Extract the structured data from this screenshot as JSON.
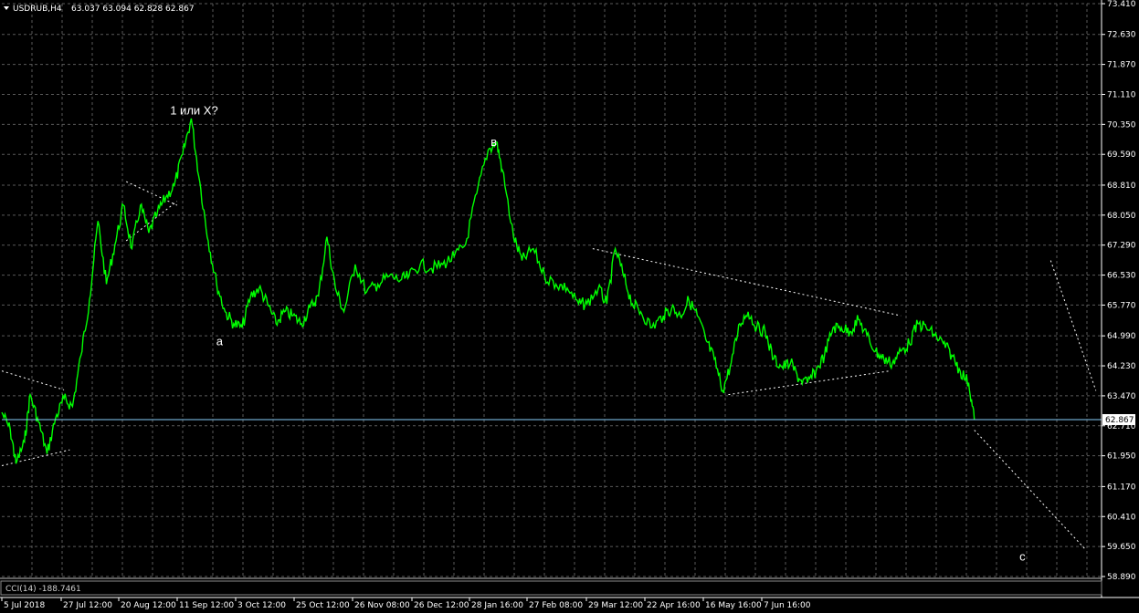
{
  "header": {
    "symbol": "USDRUB,H4",
    "ohlc": "63.037 63.094 62.828 62.867"
  },
  "indicator": {
    "label": "CCI(14) -188.7461"
  },
  "current_price": "62.867",
  "colors": {
    "background": "#000000",
    "price_line": "#00ff00",
    "grid": "#5a5a5a",
    "axis": "#ffffff",
    "annotation_line": "#ffffff",
    "current_price_line": "#87cefa"
  },
  "chart_data": {
    "type": "line",
    "title": "USDRUB,H4",
    "grid": true,
    "y_range": [
      58.89,
      73.41
    ],
    "x_ticks": [
      "5 Jul 2018",
      "27 Jul 12:00",
      "20 Aug 12:00",
      "11 Sep 12:00",
      "3 Oct 12:00",
      "25 Oct 12:00",
      "26 Nov 08:00",
      "26 Dec 12:00",
      "28 Jan 16:00",
      "27 Feb 08:00",
      "29 Mar 12:00",
      "22 Apr 16:00",
      "16 May 16:00",
      "7 Jun 16:00"
    ],
    "y_ticks": [
      "73.410",
      "72.630",
      "71.870",
      "71.110",
      "70.350",
      "69.590",
      "68.810",
      "68.050",
      "67.290",
      "66.530",
      "65.770",
      "64.990",
      "64.230",
      "63.470",
      "62.710",
      "61.950",
      "61.170",
      "60.410",
      "59.650",
      "58.890"
    ],
    "annotations": [
      {
        "text": "1 или X?",
        "x": "11 Sep 2018",
        "y": 70.6
      },
      {
        "text": "в",
        "x": "26 Dec 2018",
        "y": 69.8
      },
      {
        "text": "a",
        "x": "20 Sep 2018",
        "y": 64.75
      },
      {
        "text": "c",
        "x": "Jul 2019",
        "y": 59.3
      }
    ],
    "series": [
      {
        "values": [
          [
            "5 Jul 2018",
            63.05
          ],
          [
            "8 Jul 2018",
            62.6
          ],
          [
            "10 Jul 2018",
            61.75
          ],
          [
            "13 Jul 2018",
            62.3
          ],
          [
            "15 Jul 2018",
            63.5
          ],
          [
            "18 Jul 2018",
            62.8
          ],
          [
            "21 Jul 2018",
            62.0
          ],
          [
            "24 Jul 2018",
            62.9
          ],
          [
            "27 Jul 2018",
            63.4
          ],
          [
            "30 Jul 2018",
            63.2
          ],
          [
            "2 Aug 2018",
            64.5
          ],
          [
            "5 Aug 2018",
            65.9
          ],
          [
            "8 Aug 2018",
            67.9
          ],
          [
            "11 Aug 2018",
            66.3
          ],
          [
            "14 Aug 2018",
            67.3
          ],
          [
            "17 Aug 2018",
            68.3
          ],
          [
            "20 Aug 2018",
            67.2
          ],
          [
            "23 Aug 2018",
            68.3
          ],
          [
            "26 Aug 2018",
            67.6
          ],
          [
            "29 Aug 2018",
            68.1
          ],
          [
            "1 Sep 2018",
            68.5
          ],
          [
            "4 Sep 2018",
            68.8
          ],
          [
            "7 Sep 2018",
            69.6
          ],
          [
            "10 Sep 2018",
            70.5
          ],
          [
            "13 Sep 2018",
            68.9
          ],
          [
            "16 Sep 2018",
            67.4
          ],
          [
            "19 Sep 2018",
            66.3
          ],
          [
            "22 Sep 2018",
            65.6
          ],
          [
            "25 Sep 2018",
            65.3
          ],
          [
            "28 Sep 2018",
            65.2
          ],
          [
            "1 Oct 2018",
            66.0
          ],
          [
            "4 Oct 2018",
            66.2
          ],
          [
            "7 Oct 2018",
            65.8
          ],
          [
            "10 Oct 2018",
            65.3
          ],
          [
            "13 Oct 2018",
            65.6
          ],
          [
            "16 Oct 2018",
            65.5
          ],
          [
            "19 Oct 2018",
            65.3
          ],
          [
            "22 Oct 2018",
            65.7
          ],
          [
            "25 Oct 2018",
            66.0
          ],
          [
            "28 Oct 2018",
            67.5
          ],
          [
            "31 Oct 2018",
            66.2
          ],
          [
            "3 Nov 2018",
            65.6
          ],
          [
            "7 Nov 2018",
            66.8
          ],
          [
            "11 Nov 2018",
            66.1
          ],
          [
            "15 Nov 2018",
            66.3
          ],
          [
            "19 Nov 2018",
            66.5
          ],
          [
            "23 Nov 2018",
            66.4
          ],
          [
            "26 Nov 2018",
            66.5
          ],
          [
            "30 Nov 2018",
            66.8
          ],
          [
            "4 Dec 2018",
            66.7
          ],
          [
            "8 Dec 2018",
            66.8
          ],
          [
            "12 Dec 2018",
            67.0
          ],
          [
            "16 Dec 2018",
            67.3
          ],
          [
            "20 Dec 2018",
            68.6
          ],
          [
            "24 Dec 2018",
            69.7
          ],
          [
            "27 Dec 2018",
            69.9
          ],
          [
            "29 Dec 2018",
            69.2
          ],
          [
            "2 Jan 2019",
            67.5
          ],
          [
            "5 Jan 2019",
            66.9
          ],
          [
            "9 Jan 2019",
            67.2
          ],
          [
            "13 Jan 2019",
            66.5
          ],
          [
            "17 Jan 2019",
            66.3
          ],
          [
            "21 Jan 2019",
            66.2
          ],
          [
            "25 Jan 2019",
            65.8
          ],
          [
            "28 Jan 2019",
            65.8
          ],
          [
            "1 Feb 2019",
            66.2
          ],
          [
            "4 Feb 2019",
            65.8
          ],
          [
            "7 Feb 2019",
            67.2
          ],
          [
            "10 Feb 2019",
            66.5
          ],
          [
            "13 Feb 2019",
            65.8
          ],
          [
            "16 Feb 2019",
            65.6
          ],
          [
            "20 Feb 2019",
            65.2
          ],
          [
            "24 Feb 2019",
            65.5
          ],
          [
            "27 Feb 2019",
            65.7
          ],
          [
            "2 Mar 2019",
            65.5
          ],
          [
            "5 Mar 2019",
            65.9
          ],
          [
            "8 Mar 2019",
            65.5
          ],
          [
            "11 Mar 2019",
            64.9
          ],
          [
            "14 Mar 2019",
            64.4
          ],
          [
            "17 Mar 2019",
            63.6
          ],
          [
            "20 Mar 2019",
            64.3
          ],
          [
            "23 Mar 2019",
            65.3
          ],
          [
            "26 Mar 2019",
            65.6
          ],
          [
            "29 Mar 2019",
            65.2
          ],
          [
            "1 Apr 2019",
            65.1
          ],
          [
            "4 Apr 2019",
            64.4
          ],
          [
            "7 Apr 2019",
            64.2
          ],
          [
            "10 Apr 2019",
            64.3
          ],
          [
            "13 Apr 2019",
            63.9
          ],
          [
            "16 Apr 2019",
            63.8
          ],
          [
            "19 Apr 2019",
            64.1
          ],
          [
            "22 Apr 2019",
            64.5
          ],
          [
            "25 Apr 2019",
            65.2
          ],
          [
            "28 Apr 2019",
            65.2
          ],
          [
            "1 May 2019",
            65.1
          ],
          [
            "4 May 2019",
            65.4
          ],
          [
            "7 May 2019",
            65.0
          ],
          [
            "10 May 2019",
            64.6
          ],
          [
            "13 May 2019",
            64.4
          ],
          [
            "16 May 2019",
            64.3
          ],
          [
            "19 May 2019",
            64.6
          ],
          [
            "22 May 2019",
            64.8
          ],
          [
            "25 May 2019",
            65.3
          ],
          [
            "28 May 2019",
            65.2
          ],
          [
            "31 May 2019",
            65.0
          ],
          [
            "3 Jun 2019",
            64.8
          ],
          [
            "6 Jun 2019",
            64.5
          ],
          [
            "9 Jun 2019",
            64.1
          ],
          [
            "12 Jun 2019",
            63.8
          ],
          [
            "14 Jun 2019",
            62.87
          ]
        ]
      }
    ]
  }
}
